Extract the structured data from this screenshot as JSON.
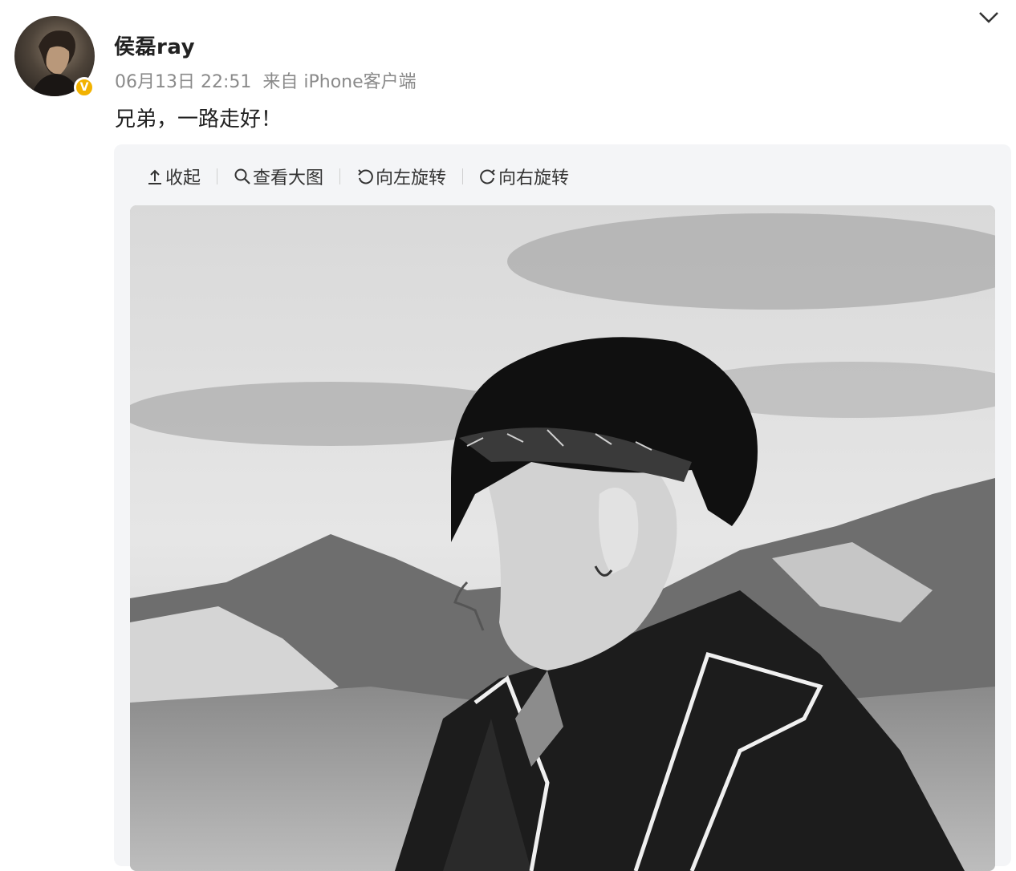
{
  "post": {
    "username": "侯磊ray",
    "date": "06月13日 22:51",
    "source": "来自 iPhone客户端",
    "text": "兄弟，一路走好！"
  },
  "toolbar": {
    "collapse_label": "收起",
    "view_large_label": "查看大图",
    "rotate_left_label": "向左旋转",
    "rotate_right_label": "向右旋转"
  },
  "icons": {
    "collapse": "arrow-up-icon",
    "view_large": "magnifier-icon",
    "rotate_left": "rotate-left-icon",
    "rotate_right": "rotate-right-icon",
    "verified": "verified-badge-icon",
    "chevron": "chevron-down-icon"
  },
  "colors": {
    "badge": "#f2b200",
    "meta_text": "#8a8a8a",
    "card_bg": "#f4f5f7"
  }
}
